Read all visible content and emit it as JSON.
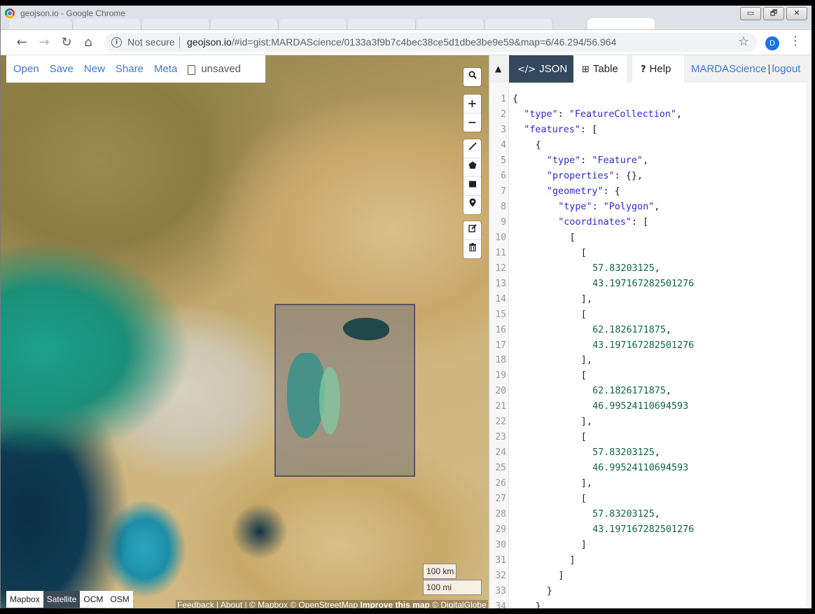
{
  "window": {
    "title": "geojson.io - Google Chrome",
    "controls": [
      "▭",
      "🗗",
      "✕"
    ]
  },
  "browser": {
    "security_label": "Not secure",
    "url_host": "geojson.io",
    "url_rest": "/#id=gist:MARDAScience/0133a3f9b7c4bec38ce5d1dbe3be9e59&map=6/46.294/56.964",
    "profile_initial": "D"
  },
  "app": {
    "menu": [
      "Open",
      "Save",
      "New",
      "Share",
      "Meta"
    ],
    "file_status": "unsaved",
    "map_controls": {
      "search": "search-icon",
      "zoom_in": "+",
      "zoom_out": "−",
      "draw_tools": [
        "line-icon",
        "polygon-icon",
        "rectangle-icon",
        "marker-icon"
      ],
      "edit_tools": [
        "edit-icon",
        "trash-icon"
      ]
    },
    "scale": {
      "km": "100 km",
      "mi": "100 mi"
    },
    "layers": [
      {
        "label": "Mapbox",
        "active": false
      },
      {
        "label": "Satellite",
        "active": true
      },
      {
        "label": "OCM",
        "active": false
      },
      {
        "label": "OSM",
        "active": false
      }
    ],
    "attribution": {
      "feedback": "Feedback",
      "about": "About",
      "mapbox": "© Mapbox",
      "osm": "© OpenStreetMap",
      "improve": "Improve this map",
      "digitalglobe": "© DigitalGlobe"
    },
    "pane": {
      "tabs": [
        {
          "label": "JSON",
          "icon": "</>",
          "active": true
        },
        {
          "label": "Table",
          "icon": "⊞",
          "active": false
        },
        {
          "label": "Help",
          "icon": "?",
          "active": false
        }
      ],
      "user": "MARDAScience",
      "logout": "logout"
    },
    "accent_color": "#3c78d8",
    "active_tab_color": "#34495e"
  },
  "json_lines": [
    {
      "n": "1",
      "i": 0,
      "parts": [
        [
          "p",
          "{"
        ]
      ]
    },
    {
      "n": "2",
      "i": 1,
      "parts": [
        [
          "k",
          "\"type\""
        ],
        [
          "p",
          ": "
        ],
        [
          "s",
          "\"FeatureCollection\""
        ],
        [
          "p",
          ","
        ]
      ]
    },
    {
      "n": "3",
      "i": 1,
      "parts": [
        [
          "k",
          "\"features\""
        ],
        [
          "p",
          ": ["
        ]
      ]
    },
    {
      "n": "4",
      "i": 2,
      "parts": [
        [
          "p",
          "{"
        ]
      ]
    },
    {
      "n": "5",
      "i": 3,
      "parts": [
        [
          "k",
          "\"type\""
        ],
        [
          "p",
          ": "
        ],
        [
          "s",
          "\"Feature\""
        ],
        [
          "p",
          ","
        ]
      ]
    },
    {
      "n": "6",
      "i": 3,
      "parts": [
        [
          "k",
          "\"properties\""
        ],
        [
          "p",
          ": {},"
        ]
      ]
    },
    {
      "n": "7",
      "i": 3,
      "parts": [
        [
          "k",
          "\"geometry\""
        ],
        [
          "p",
          ": {"
        ]
      ]
    },
    {
      "n": "8",
      "i": 4,
      "parts": [
        [
          "k",
          "\"type\""
        ],
        [
          "p",
          ": "
        ],
        [
          "s",
          "\"Polygon\""
        ],
        [
          "p",
          ","
        ]
      ]
    },
    {
      "n": "9",
      "i": 4,
      "parts": [
        [
          "k",
          "\"coordinates\""
        ],
        [
          "p",
          ": ["
        ]
      ]
    },
    {
      "n": "10",
      "i": 5,
      "parts": [
        [
          "p",
          "["
        ]
      ]
    },
    {
      "n": "11",
      "i": 6,
      "parts": [
        [
          "p",
          "["
        ]
      ]
    },
    {
      "n": "12",
      "i": 7,
      "parts": [
        [
          "n",
          "57.83203125"
        ],
        [
          "p",
          ","
        ]
      ]
    },
    {
      "n": "13",
      "i": 7,
      "parts": [
        [
          "n",
          "43.197167282501276"
        ]
      ]
    },
    {
      "n": "14",
      "i": 6,
      "parts": [
        [
          "p",
          "],"
        ]
      ]
    },
    {
      "n": "15",
      "i": 6,
      "parts": [
        [
          "p",
          "["
        ]
      ]
    },
    {
      "n": "16",
      "i": 7,
      "parts": [
        [
          "n",
          "62.1826171875"
        ],
        [
          "p",
          ","
        ]
      ]
    },
    {
      "n": "17",
      "i": 7,
      "parts": [
        [
          "n",
          "43.197167282501276"
        ]
      ]
    },
    {
      "n": "18",
      "i": 6,
      "parts": [
        [
          "p",
          "],"
        ]
      ]
    },
    {
      "n": "19",
      "i": 6,
      "parts": [
        [
          "p",
          "["
        ]
      ]
    },
    {
      "n": "20",
      "i": 7,
      "parts": [
        [
          "n",
          "62.1826171875"
        ],
        [
          "p",
          ","
        ]
      ]
    },
    {
      "n": "21",
      "i": 7,
      "parts": [
        [
          "n",
          "46.99524110694593"
        ]
      ]
    },
    {
      "n": "22",
      "i": 6,
      "parts": [
        [
          "p",
          "],"
        ]
      ]
    },
    {
      "n": "23",
      "i": 6,
      "parts": [
        [
          "p",
          "["
        ]
      ]
    },
    {
      "n": "24",
      "i": 7,
      "parts": [
        [
          "n",
          "57.83203125"
        ],
        [
          "p",
          ","
        ]
      ]
    },
    {
      "n": "25",
      "i": 7,
      "parts": [
        [
          "n",
          "46.99524110694593"
        ]
      ]
    },
    {
      "n": "26",
      "i": 6,
      "parts": [
        [
          "p",
          "],"
        ]
      ]
    },
    {
      "n": "27",
      "i": 6,
      "parts": [
        [
          "p",
          "["
        ]
      ]
    },
    {
      "n": "28",
      "i": 7,
      "parts": [
        [
          "n",
          "57.83203125"
        ],
        [
          "p",
          ","
        ]
      ]
    },
    {
      "n": "29",
      "i": 7,
      "parts": [
        [
          "n",
          "43.197167282501276"
        ]
      ]
    },
    {
      "n": "30",
      "i": 6,
      "parts": [
        [
          "p",
          "]"
        ]
      ]
    },
    {
      "n": "31",
      "i": 5,
      "parts": [
        [
          "p",
          "]"
        ]
      ]
    },
    {
      "n": "32",
      "i": 4,
      "parts": [
        [
          "p",
          "]"
        ]
      ]
    },
    {
      "n": "33",
      "i": 3,
      "parts": [
        [
          "p",
          "}"
        ]
      ]
    },
    {
      "n": "34",
      "i": 2,
      "parts": [
        [
          "p",
          "}"
        ]
      ]
    }
  ]
}
